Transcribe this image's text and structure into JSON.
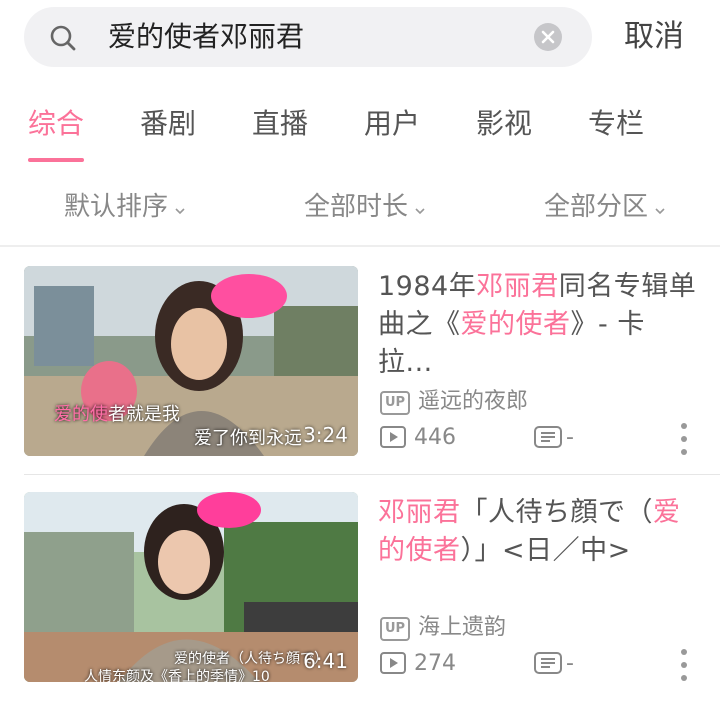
{
  "search": {
    "query": "爱的使者邓丽君",
    "cancel_label": "取消"
  },
  "tabs": [
    {
      "label": "综合",
      "active": true
    },
    {
      "label": "番剧",
      "active": false
    },
    {
      "label": "直播",
      "active": false
    },
    {
      "label": "用户",
      "active": false
    },
    {
      "label": "影视",
      "active": false
    },
    {
      "label": "专栏",
      "active": false
    }
  ],
  "filters": [
    "默认排序",
    "全部时长",
    "全部分区"
  ],
  "results": [
    {
      "title_parts": [
        {
          "text": "1984年",
          "hl": false
        },
        {
          "text": "邓丽君",
          "hl": true
        },
        {
          "text": "同名专辑单曲之《",
          "hl": false
        },
        {
          "text": "爱的使者",
          "hl": true
        },
        {
          "text": "》- 卡拉...",
          "hl": false
        }
      ],
      "duration": "3:24",
      "subtitle_1_hl": "爱的使",
      "subtitle_1": "者就是我",
      "subtitle_2": "爱了你到永远",
      "up_badge": "UP",
      "uploader": "遥远的夜郎",
      "views": "446",
      "danmaku": "-"
    },
    {
      "title_parts": [
        {
          "text": "邓丽君",
          "hl": true
        },
        {
          "text": "「人待ち顔で（",
          "hl": false
        },
        {
          "text": "爱的使者",
          "hl": true
        },
        {
          "text": "）」<日／中>",
          "hl": false
        }
      ],
      "duration": "6:41",
      "subtitle_1": "爱的使者（人待ち顔で）",
      "subtitle_bottom": "人情东颜及《香上的季情》10",
      "up_badge": "UP",
      "uploader": "海上遗韵",
      "views": "274",
      "danmaku": "-"
    }
  ],
  "colors": {
    "accent": "#fb7299",
    "text_secondary": "#888888",
    "search_bg": "#f1f1f3"
  },
  "icons": [
    "search-icon",
    "clear-icon",
    "chevron-down-icon",
    "play-count-icon",
    "danmaku-icon",
    "more-vertical-icon"
  ]
}
